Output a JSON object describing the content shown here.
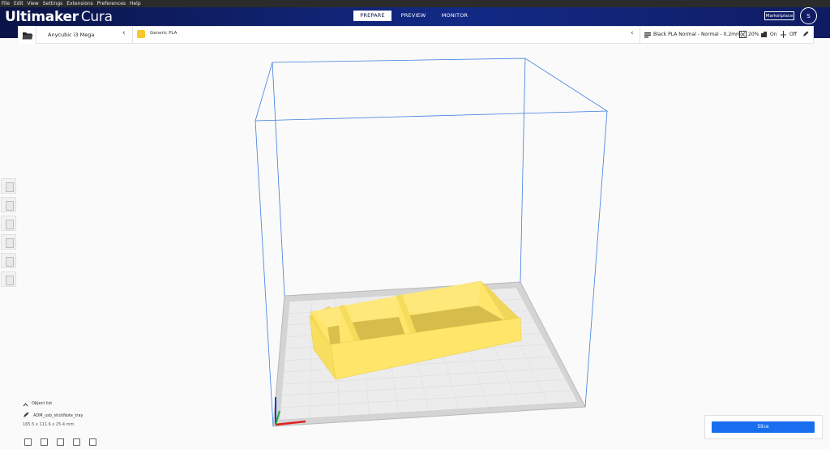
{
  "menu": [
    "File",
    "Edit",
    "View",
    "Settings",
    "Extensions",
    "Preferences",
    "Help"
  ],
  "app": {
    "brand_bold": "Ultimaker",
    "brand_light": "Cura"
  },
  "tabs": [
    {
      "label": "PREPARE",
      "active": true
    },
    {
      "label": "PREVIEW",
      "active": false
    },
    {
      "label": "MONITOR",
      "active": false
    }
  ],
  "marketplace_label": "Marketplace",
  "user_initial": "S",
  "printer_name": "Anycubic i3 Mega",
  "material_label": "Generic PLA",
  "profile_label": "Black PLA Normal - Normal - 0.2mm",
  "infill_value": "20%",
  "support_value": "On",
  "adhesion_value": "Off",
  "object_list_label": "Object list",
  "object_filename": "ADM_usb_stickNote_tray",
  "object_dimensions": "165.5 x 111.6 x 25.4 mm",
  "slice_label": "Slice",
  "colors": {
    "accent": "#196ef0",
    "header": "#122a86",
    "model": "#ffe66a",
    "build_volume": "#3d7ee0"
  }
}
